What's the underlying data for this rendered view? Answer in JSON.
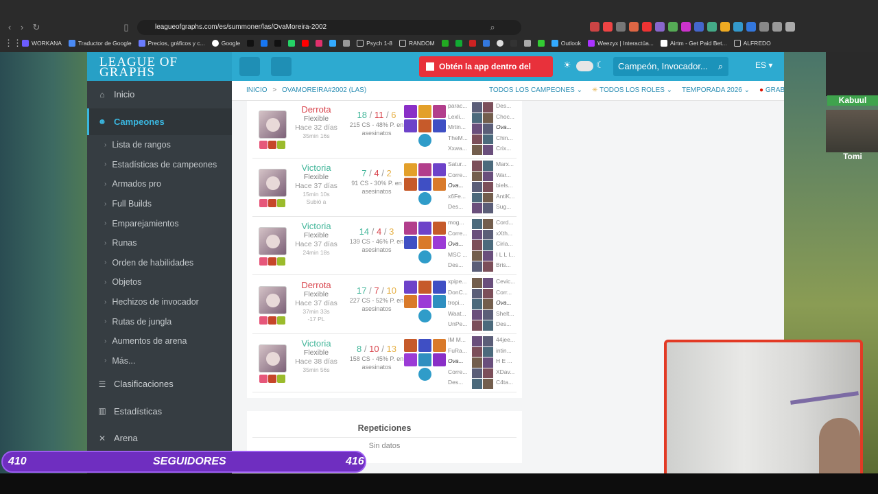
{
  "browser": {
    "url": "leagueofgraphs.com/es/summoner/las/OvaMoreira-2002",
    "bookmarks": [
      "WORKANA",
      "Traductor de Google",
      "Precios, gráficos y c...",
      "Google",
      "",
      "",
      "",
      "",
      "",
      "",
      "",
      "",
      "Psych 1-8",
      "RANDOM",
      "",
      "",
      "",
      "",
      "",
      "",
      "",
      "",
      "Outlook",
      "Weezyx | Interactúa...",
      "Airtm - Get Paid Bet...",
      "ALFREDO"
    ]
  },
  "site": {
    "logo": "LEAGUE OF GRAPHS",
    "cta": "Obtén la app dentro del juego",
    "search_placeholder": "Campeón, Invocador...",
    "lang": "ES"
  },
  "sidebar": {
    "main": [
      {
        "label": "Inicio",
        "icon": "home-icon"
      },
      {
        "label": "Campeones",
        "icon": "users-icon",
        "active": true
      }
    ],
    "sub": [
      "Lista de rangos",
      "Estadísticas de campeones",
      "Armados pro",
      "Full Builds",
      "Emparejamientos",
      "Runas",
      "Orden de habilidades",
      "Objetos",
      "Hechizos de invocador",
      "Rutas de jungla",
      "Aumentos de arena",
      "Más..."
    ],
    "bottom": [
      {
        "label": "Clasificaciones",
        "icon": "list-icon"
      },
      {
        "label": "Estadísticas",
        "icon": "bar-chart-icon"
      },
      {
        "label": "Arena",
        "icon": "swords-icon"
      }
    ]
  },
  "breadcrumb": {
    "home": "INICIO",
    "sep": ">",
    "player": "OVAMOREIRA#2002 (LAS)"
  },
  "filters": [
    "TODOS LOS CAMPEONES",
    "TODOS LOS ROLES",
    "TEMPORADA 2026",
    "GRABAR"
  ],
  "matches": [
    {
      "outcome": "Derrota",
      "win": false,
      "queue": "Flexible",
      "ago": "Hace 32 días",
      "duration": "35min 16s",
      "extra": "",
      "k": "18",
      "d": "11",
      "a": "6",
      "cs": "215",
      "pct": "48%",
      "cs_text": "CS -",
      "pct_text": "P. en",
      "kill_text": "asesinatos",
      "team1": [
        "parac...",
        "Lexli...",
        "Mrtin...",
        "TheM...",
        "Xxwa..."
      ],
      "team2": [
        "Des...",
        "Choc...",
        "Ova...",
        "Chin...",
        "Crix..."
      ],
      "me_side": 2,
      "me_idx": 2
    },
    {
      "outcome": "Victoria",
      "win": true,
      "queue": "Flexible",
      "ago": "Hace 37 días",
      "duration": "15min 10s",
      "extra": "Subió a",
      "k": "7",
      "d": "4",
      "a": "2",
      "cs": "91",
      "pct": "30%",
      "cs_text": "CS -",
      "pct_text": "P. en",
      "kill_text": "asesinatos",
      "team1": [
        "Satur...",
        "Corre...",
        "Ova...",
        "x6Fe...",
        "Des..."
      ],
      "team2": [
        "Marx...",
        "War...",
        "biels...",
        "AntiK...",
        "Sug..."
      ],
      "me_side": 1,
      "me_idx": 2
    },
    {
      "outcome": "Victoria",
      "win": true,
      "queue": "Flexible",
      "ago": "Hace 37 días",
      "duration": "24min 18s",
      "extra": "",
      "k": "14",
      "d": "4",
      "a": "3",
      "cs": "139",
      "pct": "46%",
      "cs_text": "CS -",
      "pct_text": "P. en",
      "kill_text": "asesinatos",
      "team1": [
        "mog...",
        "Corre...",
        "Ova...",
        "MSC ...",
        "Des..."
      ],
      "team2": [
        "Cord...",
        "xXth...",
        "Ciria...",
        "I L L I...",
        "Bris..."
      ],
      "me_side": 1,
      "me_idx": 2
    },
    {
      "outcome": "Derrota",
      "win": false,
      "queue": "Flexible",
      "ago": "Hace 37 días",
      "duration": "37min 33s",
      "extra": "-17 PL",
      "k": "17",
      "d": "7",
      "a": "10",
      "cs": "227",
      "pct": "52%",
      "cs_text": "CS -",
      "pct_text": "P. en",
      "kill_text": "asesinatos",
      "team1": [
        "xpipe...",
        "DonC...",
        "tropi...",
        "Waat...",
        "UnPe..."
      ],
      "team2": [
        "Cevic...",
        "Corr...",
        "Ova...",
        "Shelt...",
        "Des..."
      ],
      "me_side": 2,
      "me_idx": 2
    },
    {
      "outcome": "Victoria",
      "win": true,
      "queue": "Flexible",
      "ago": "Hace 38 días",
      "duration": "35min 56s",
      "extra": "",
      "k": "8",
      "d": "10",
      "a": "13",
      "cs": "158",
      "pct": "45%",
      "cs_text": "CS -",
      "pct_text": "P. en",
      "kill_text": "asesinatos",
      "team1": [
        "IM M...",
        "FuRa...",
        "Ova...",
        "Corre...",
        "Des..."
      ],
      "team2": [
        "44jee...",
        "intin...",
        "H E ...",
        "XDav...",
        "C4ta..."
      ],
      "me_side": 1,
      "me_idx": 2
    }
  ],
  "replays": {
    "title": "Repeticiones",
    "empty": "Sin datos"
  },
  "stream": {
    "cam1_name": "Kabuul",
    "cam2_name": "Tomi",
    "followers_left": "410",
    "followers_label": "SEGUIDORES",
    "followers_right": "416"
  },
  "colors": {
    "site_accent": "#2daad0",
    "loss": "#d8434b",
    "win": "#43b69a",
    "assist": "#e6b045",
    "cta": "#e8313b",
    "followers_bar": "#6f2ec0"
  }
}
